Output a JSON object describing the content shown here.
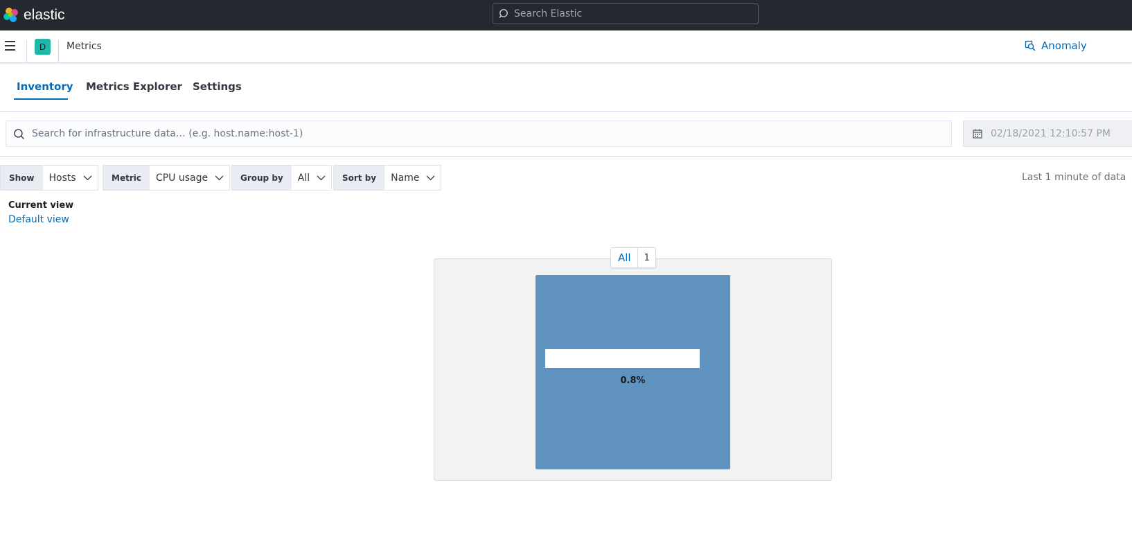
{
  "header": {
    "logo_text": "elastic",
    "search_placeholder": "Search Elastic"
  },
  "subheader": {
    "space_initial": "D",
    "breadcrumb": "Metrics",
    "anomaly_label": "Anomaly"
  },
  "tabs": [
    {
      "label": "Inventory",
      "active": true
    },
    {
      "label": "Metrics Explorer",
      "active": false
    },
    {
      "label": "Settings",
      "active": false
    }
  ],
  "search": {
    "placeholder": "Search for infrastructure data… (e.g. host.name:host-1)"
  },
  "date_picker": {
    "value": "02/18/2021 12:10:57 PM"
  },
  "toolbar": {
    "show": {
      "label": "Show",
      "value": "Hosts"
    },
    "metric": {
      "label": "Metric",
      "value": "CPU usage"
    },
    "group_by": {
      "label": "Group by",
      "value": "All"
    },
    "sort_by": {
      "label": "Sort by",
      "value": "Name"
    },
    "last_updated": "Last 1 minute of data"
  },
  "saved_view": {
    "label": "Current view",
    "name": "Default view"
  },
  "map": {
    "group": {
      "name": "All",
      "count": "1"
    },
    "nodes": [
      {
        "name": "",
        "value": "0.8%",
        "color": "#6092c0"
      }
    ]
  },
  "colors": {
    "header_bg": "#25282f",
    "accent": "#006bb8",
    "space_badge": "#20b7a8",
    "node_fill": "#6092c0"
  }
}
